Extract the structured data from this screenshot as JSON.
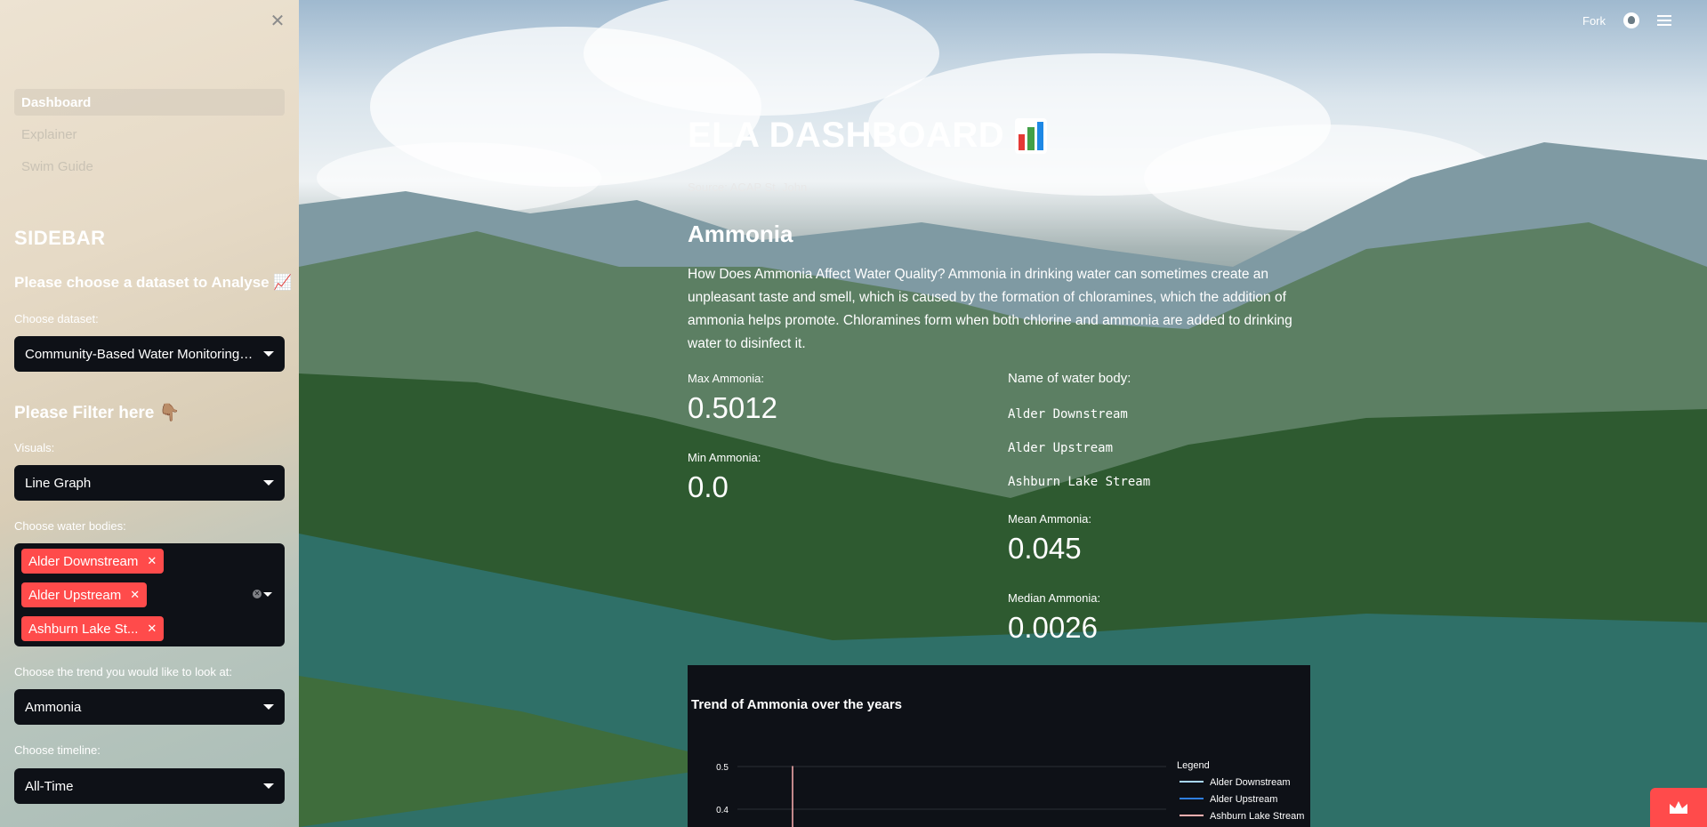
{
  "sidebar": {
    "nav": [
      {
        "label": "Dashboard",
        "active": true
      },
      {
        "label": "Explainer",
        "active": false
      },
      {
        "label": "Swim Guide",
        "active": false
      }
    ],
    "header": "SIDEBAR",
    "dataset_heading": "Please choose a dataset to Analyse 📈",
    "dataset_label": "Choose dataset:",
    "dataset_value": "Community-Based Water Monitoring Data",
    "filter_heading": "Please Filter here 👇🏽",
    "visuals_label": "Visuals:",
    "visuals_value": "Line Graph",
    "water_bodies_label": "Choose water bodies:",
    "water_bodies": [
      "Alder Downstream",
      "Alder Upstream",
      "Ashburn Lake St..."
    ],
    "trend_label": "Choose the trend you would like to look at:",
    "trend_value": "Ammonia",
    "timeline_label": "Choose timeline:",
    "timeline_value": "All-Time"
  },
  "topbar": {
    "fork": "Fork"
  },
  "main": {
    "title": "ELA DASHBOARD",
    "source": "Source: ACAP St. John",
    "section": "Ammonia",
    "paragraph": "How Does Ammonia Affect Water Quality? Ammonia in drinking water can sometimes create an unpleasant taste and smell, which is caused by the formation of chloramines, which the addition of ammonia helps promote. Chloramines form when both chlorine and ammonia are added to drinking water to disinfect it.",
    "metrics": {
      "max_label": "Max Ammonia:",
      "max_value": "0.5012",
      "min_label": "Min Ammonia:",
      "min_value": "0.0",
      "names_label": "Name of water body:",
      "names": [
        "Alder Downstream",
        "Alder Upstream",
        "Ashburn Lake Stream"
      ],
      "mean_label": "Mean Ammonia:",
      "mean_value": "0.045",
      "median_label": "Median Ammonia:",
      "median_value": "0.0026"
    }
  },
  "chart_data": {
    "type": "line",
    "title": "Trend of Ammonia over the years",
    "legend_title": "Legend",
    "legend_position": "top-right",
    "y_ticks": [
      0.5,
      0.4
    ],
    "series": [
      {
        "name": "Alder Downstream",
        "color": "#a9d7ff"
      },
      {
        "name": "Alder Upstream",
        "color": "#2f7fe0"
      },
      {
        "name": "Ashburn Lake Stream",
        "color": "#ffb0b0"
      }
    ],
    "visible_spike": {
      "series": "Ashburn Lake Stream",
      "y": 0.5012
    }
  },
  "colors": {
    "accent": "#ff4b4b",
    "widget_bg": "#0e1117"
  }
}
